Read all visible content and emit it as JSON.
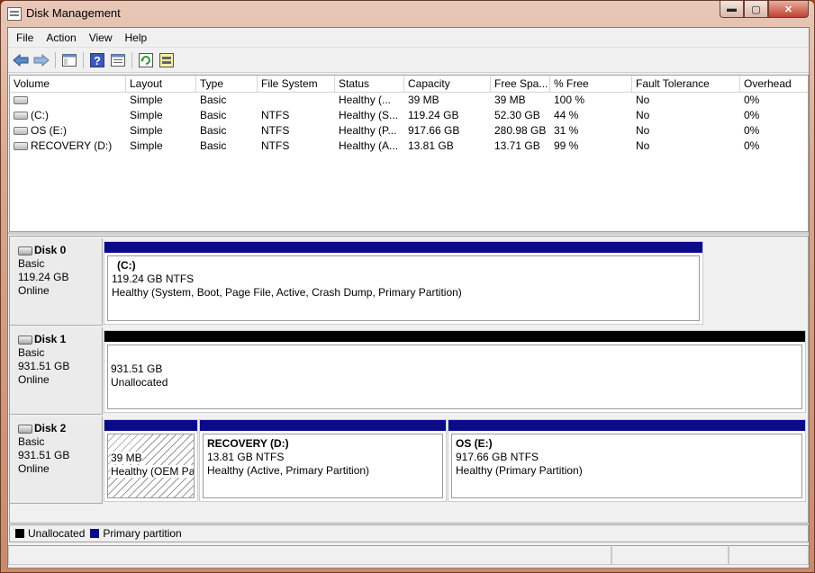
{
  "window": {
    "title": "Disk Management",
    "min_label": "▬",
    "max_label": "▢",
    "close_label": "✕"
  },
  "menu": [
    "File",
    "Action",
    "View",
    "Help"
  ],
  "toolbar": [
    "back-icon",
    "forward-icon",
    "console-tree-icon",
    "help-icon",
    "properties-icon",
    "refresh-icon",
    "rescan-disks-icon"
  ],
  "columns": [
    "Volume",
    "Layout",
    "Type",
    "File System",
    "Status",
    "Capacity",
    "Free Spa...",
    "% Free",
    "Fault Tolerance",
    "Overhead"
  ],
  "volumes": [
    {
      "volume": "",
      "layout": "Simple",
      "type": "Basic",
      "fs": "",
      "status": "Healthy (...",
      "capacity": "39 MB",
      "free": "39 MB",
      "pct": "100 %",
      "ft": "No",
      "overhead": "0%"
    },
    {
      "volume": "(C:)",
      "layout": "Simple",
      "type": "Basic",
      "fs": "NTFS",
      "status": "Healthy (S...",
      "capacity": "119.24 GB",
      "free": "52.30 GB",
      "pct": "44 %",
      "ft": "No",
      "overhead": "0%"
    },
    {
      "volume": "OS (E:)",
      "layout": "Simple",
      "type": "Basic",
      "fs": "NTFS",
      "status": "Healthy (P...",
      "capacity": "917.66 GB",
      "free": "280.98 GB",
      "pct": "31 %",
      "ft": "No",
      "overhead": "0%"
    },
    {
      "volume": "RECOVERY (D:)",
      "layout": "Simple",
      "type": "Basic",
      "fs": "NTFS",
      "status": "Healthy (A...",
      "capacity": "13.81 GB",
      "free": "13.71 GB",
      "pct": "99 %",
      "ft": "No",
      "overhead": "0%"
    }
  ],
  "disks": [
    {
      "name": "Disk 0",
      "type": "Basic",
      "size": "119.24 GB",
      "state": "Online",
      "partitions": [
        {
          "title": "(C:)",
          "line1": "119.24 GB NTFS",
          "line2": "Healthy (System, Boot, Page File, Active, Crash Dump, Primary Partition)"
        }
      ]
    },
    {
      "name": "Disk 1",
      "type": "Basic",
      "size": "931.51 GB",
      "state": "Online",
      "partitions": [
        {
          "title": "",
          "line1": "931.51 GB",
          "line2": "Unallocated"
        }
      ]
    },
    {
      "name": "Disk 2",
      "type": "Basic",
      "size": "931.51 GB",
      "state": "Online",
      "partitions": [
        {
          "title": "",
          "line1": "39 MB",
          "line2": "Healthy (OEM Pa"
        },
        {
          "title": "RECOVERY  (D:)",
          "line1": "13.81 GB NTFS",
          "line2": "Healthy (Active, Primary Partition)"
        },
        {
          "title": "OS  (E:)",
          "line1": "917.66 GB NTFS",
          "line2": "Healthy (Primary Partition)"
        }
      ]
    }
  ],
  "legend": [
    {
      "label": "Unallocated",
      "color": "#000000"
    },
    {
      "label": "Primary partition",
      "color": "#0a0a8a"
    }
  ]
}
